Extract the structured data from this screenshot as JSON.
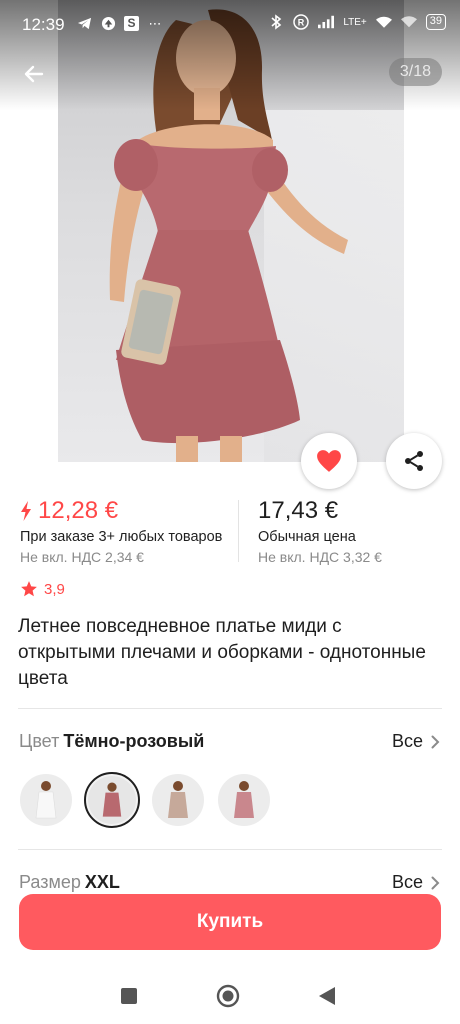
{
  "status_bar": {
    "time": "12:39",
    "network": "LTE+",
    "battery": "39"
  },
  "gallery": {
    "counter": "3/18"
  },
  "pricing": {
    "promo": {
      "price": "12,28 €",
      "condition": "При заказе 3+ любых товаров",
      "vat": "Не вкл. НДС 2,34 €"
    },
    "regular": {
      "price": "17,43 €",
      "label": "Обычная цена",
      "vat": "Не вкл. НДС 3,32 €"
    }
  },
  "rating": {
    "value": "3,9"
  },
  "product": {
    "title": "Летнее повседневное платье миди с открытыми плечами и оборками - однотонные цвета"
  },
  "color": {
    "label": "Цвет",
    "value": "Тёмно-розовый",
    "all_label": "Все",
    "swatches": [
      {
        "color": "white",
        "dress_hex": "#f4f4f4"
      },
      {
        "color": "dark-pink",
        "dress_hex": "#b8696f",
        "selected": true
      },
      {
        "color": "beige",
        "dress_hex": "#c6a99a"
      },
      {
        "color": "pink",
        "dress_hex": "#c9878d"
      }
    ]
  },
  "size": {
    "label": "Размер",
    "value": "XXL",
    "all_label": "Все"
  },
  "actions": {
    "buy_label": "Купить"
  },
  "theme": {
    "accent": "#ff4747",
    "button": "#ff5a5f",
    "dress": "#b8696f"
  }
}
